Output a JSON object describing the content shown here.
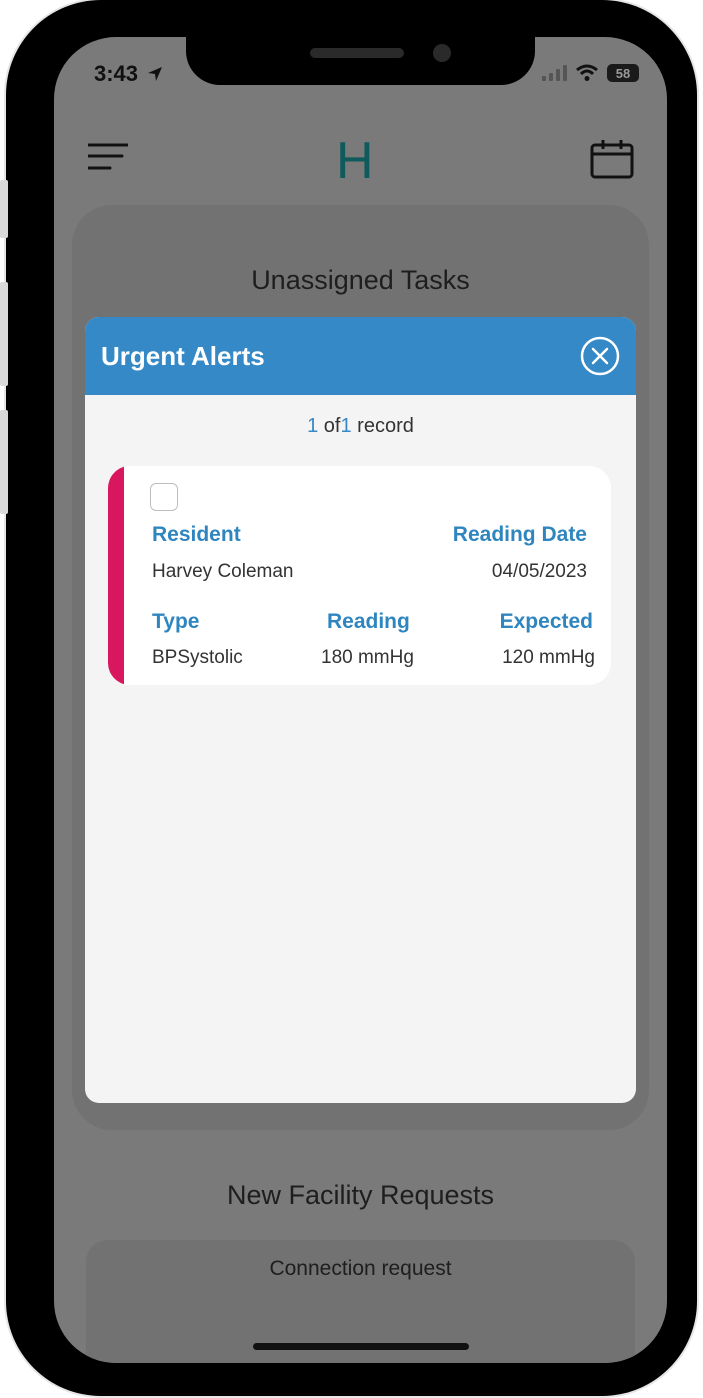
{
  "status_bar": {
    "time": "3:43",
    "battery": "58"
  },
  "app": {
    "logo": "H"
  },
  "background": {
    "unassigned_title": "Unassigned Tasks",
    "facility_title": "New Facility Requests",
    "connection_request": "Connection request"
  },
  "modal": {
    "title": "Urgent Alerts",
    "count_current": "1",
    "count_of": "of",
    "count_total": "1",
    "count_suffix": "record",
    "alert": {
      "resident_label": "Resident",
      "resident_value": "Harvey Coleman",
      "reading_date_label": "Reading Date",
      "reading_date_value": "04/05/2023",
      "type_label": "Type",
      "type_value": "BPSystolic",
      "reading_label": "Reading",
      "reading_value": "180 mmHg",
      "expected_label": "Expected",
      "expected_value": "120 mmHg"
    }
  },
  "colors": {
    "header_blue": "#3589c6",
    "alert_accent": "#d8175e",
    "logo_teal": "#0f5a5c"
  }
}
